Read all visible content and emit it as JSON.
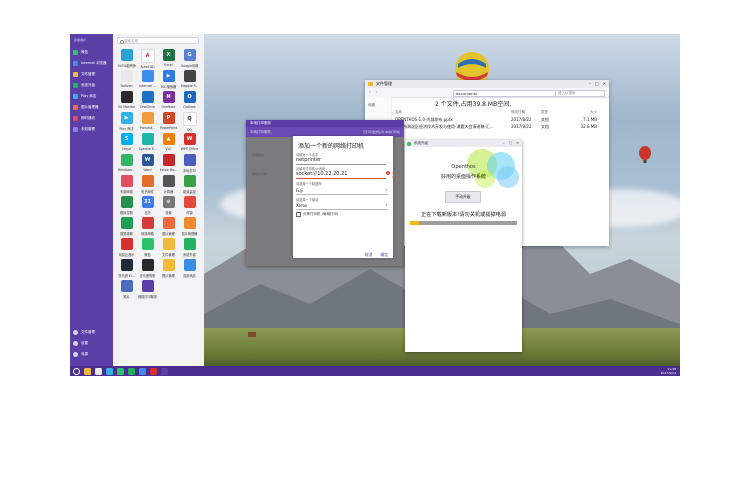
{
  "sidebar": {
    "header": "高级用户",
    "items": [
      {
        "label": "微信",
        "color": "#2cc36b"
      },
      {
        "label": "Internet 浏览器",
        "color": "#3d8df0"
      },
      {
        "label": "文件管理",
        "color": "#f0b93a"
      },
      {
        "label": "系统升级",
        "color": "#21b15f"
      },
      {
        "label": "Play 商店",
        "color": "#33b0e6"
      },
      {
        "label": "图片管理器",
        "color": "#ef6b3d"
      },
      {
        "label": "即时通讯",
        "color": "#e24d62"
      },
      {
        "label": "未知管理",
        "color": "#8d7be6"
      }
    ],
    "bottom": [
      {
        "label": "文件管理"
      },
      {
        "label": "设置"
      },
      {
        "label": "电源"
      }
    ]
  },
  "apps": {
    "search_placeholder": "搜索应用",
    "list": [
      {
        "label": "100%脑残师",
        "color": "#29a3d6",
        "glyph": ""
      },
      {
        "label": "AutoCAD",
        "color": "#ffffff",
        "glyph": "A",
        "fg": "#d8232a"
      },
      {
        "label": "Excel",
        "color": "#1f7244",
        "glyph": "X"
      },
      {
        "label": "Google设置",
        "color": "#5a7fd6",
        "glyph": "G"
      },
      {
        "label": "Notizen",
        "color": "#e9e9e9",
        "glyph": "",
        "fg": "#333"
      },
      {
        "label": "Internet ...",
        "color": "#3d8df0",
        "glyph": ""
      },
      {
        "label": "MX 播放器",
        "color": "#2e7be0",
        "glyph": "▶"
      },
      {
        "label": "Mapple P...",
        "color": "#444444",
        "glyph": ""
      },
      {
        "label": "OS Monitor",
        "color": "#2a2a2a",
        "glyph": ""
      },
      {
        "label": "OneDrive",
        "color": "#1e72c4",
        "glyph": ""
      },
      {
        "label": "OneNote",
        "color": "#7a2f9e",
        "glyph": "N"
      },
      {
        "label": "Outlook",
        "color": "#1d66c2",
        "glyph": "O"
      },
      {
        "label": "Play 商店",
        "color": "#33b0e6",
        "glyph": "▶"
      },
      {
        "label": "Podcast...",
        "color": "#f39c3a",
        "glyph": ""
      },
      {
        "label": "PowerPoint",
        "color": "#d24726",
        "glyph": "P"
      },
      {
        "label": "QQ",
        "color": "#ffffff",
        "glyph": "Q",
        "fg": "#222"
      },
      {
        "label": "Skype",
        "color": "#00aff0",
        "glyph": "S"
      },
      {
        "label": "Sparkle P...",
        "color": "#1cb7a8",
        "glyph": ""
      },
      {
        "label": "VLC",
        "color": "#f07f00",
        "glyph": "▲"
      },
      {
        "label": "WPS Office",
        "color": "#d8302f",
        "glyph": "W"
      },
      {
        "label": "Windows...",
        "color": "#35b56a",
        "glyph": ""
      },
      {
        "label": "Word",
        "color": "#2b579a",
        "glyph": "W"
      },
      {
        "label": "Xerox Mo...",
        "color": "#c5252c",
        "glyph": ""
      },
      {
        "label": "本地打印",
        "color": "#4a5fc0",
        "glyph": ""
      },
      {
        "label": "车载网络",
        "color": "#e24d62",
        "glyph": ""
      },
      {
        "label": "电子邮件",
        "color": "#e46c2b",
        "glyph": ""
      },
      {
        "label": "计算器",
        "color": "#555555",
        "glyph": ""
      },
      {
        "label": "能效监控",
        "color": "#3aa048",
        "glyph": ""
      },
      {
        "label": "模拟控制",
        "color": "#2a8f4e",
        "glyph": ""
      },
      {
        "label": "日历",
        "color": "#3f7ee8",
        "glyph": "31"
      },
      {
        "label": "设置",
        "color": "#777777",
        "glyph": "⚙"
      },
      {
        "label": "时钟",
        "color": "#e34c3c",
        "glyph": ""
      },
      {
        "label": "搜狐视频",
        "color": "#1f9d55",
        "glyph": ""
      },
      {
        "label": "网易邮箱",
        "color": "#d63a3a",
        "glyph": ""
      },
      {
        "label": "图片管理",
        "color": "#ef6b3d",
        "glyph": ""
      },
      {
        "label": "图片管理器",
        "color": "#f28b30",
        "glyph": ""
      },
      {
        "label": "网易云音乐",
        "color": "#d8302f",
        "glyph": ""
      },
      {
        "label": "微信",
        "color": "#2cc36b",
        "glyph": ""
      },
      {
        "label": "文件管理",
        "color": "#f0b93a",
        "glyph": ""
      },
      {
        "label": "系统升级",
        "color": "#21b15f",
        "glyph": ""
      },
      {
        "label": "亚马逊 Ki...",
        "color": "#1f2b3a",
        "glyph": ""
      },
      {
        "label": "亚马逊购物",
        "color": "#2a2a2a",
        "glyph": ""
      },
      {
        "label": "照片管理",
        "color": "#f0b93a",
        "glyph": ""
      },
      {
        "label": "应用商店",
        "color": "#3a8de6",
        "glyph": ""
      },
      {
        "label": "照片",
        "color": "#4a6fbf",
        "glyph": ""
      },
      {
        "label": "网络打印服务",
        "color": "#5b3da8",
        "glyph": ""
      }
    ]
  },
  "taskbar": {
    "clock_time": "11:48",
    "clock_date": "2017/9/24",
    "icons": [
      "#f0b93a",
      "#e9e9e9",
      "#33b0e6",
      "#2cc36b",
      "#21b15f",
      "#3d8df0",
      "#d8302f",
      "#5a3fa7"
    ]
  },
  "file_manager": {
    "title": "文件管理",
    "path": "documents",
    "search_placeholder": "键入以搜索",
    "summary": "2 个文件,占用39.8 MB空间,",
    "side_label": "收藏",
    "headers": {
      "name": "名称",
      "date": "修改日期",
      "type": "类型",
      "size": "大小"
    },
    "rows": [
      {
        "name": "OPENTHOS-1.0-内部发布.pptx",
        "date": "2017/8/22",
        "type": "文档",
        "size": "7.1 MB"
      },
      {
        "name": "北京市海淀区经济技术开发与使用-课题大会演讲稿-汇...",
        "date": "2017/8/22",
        "type": "文档",
        "size": "32.8 MB"
      }
    ]
  },
  "printer_window": {
    "title": "本地打印服务",
    "subtitle": "本地打印服务",
    "tabs": "已打印发送队列    本地打印机",
    "side_items": [
      "已添加的",
      "未知打印机"
    ],
    "dialog": {
      "title": "添加一个新的网络打印机",
      "name_label": "请填写一个名字",
      "name_value": "netprinter",
      "url_label": "请填写打印机uri地址",
      "url_value": "socket://10.22.20.21",
      "url_hint": "示例",
      "mfr_label": "请选择一个制造商",
      "mfr_value": "Fuji",
      "model_label": "请选择一个驱动",
      "model_value": "Xerox",
      "checkbox_label": "分享打印机 (局域打印)",
      "cancel": "取消",
      "ok": "确定"
    }
  },
  "update_dialog": {
    "title": "系统升级",
    "brand": "Openthos",
    "tagline": "好用的桌面操作系统",
    "button": "手动升级",
    "message": "正在下载新版本!请勿关机或拔掉电源",
    "progress": 0.08,
    "progress_color": "#f2b90f"
  }
}
